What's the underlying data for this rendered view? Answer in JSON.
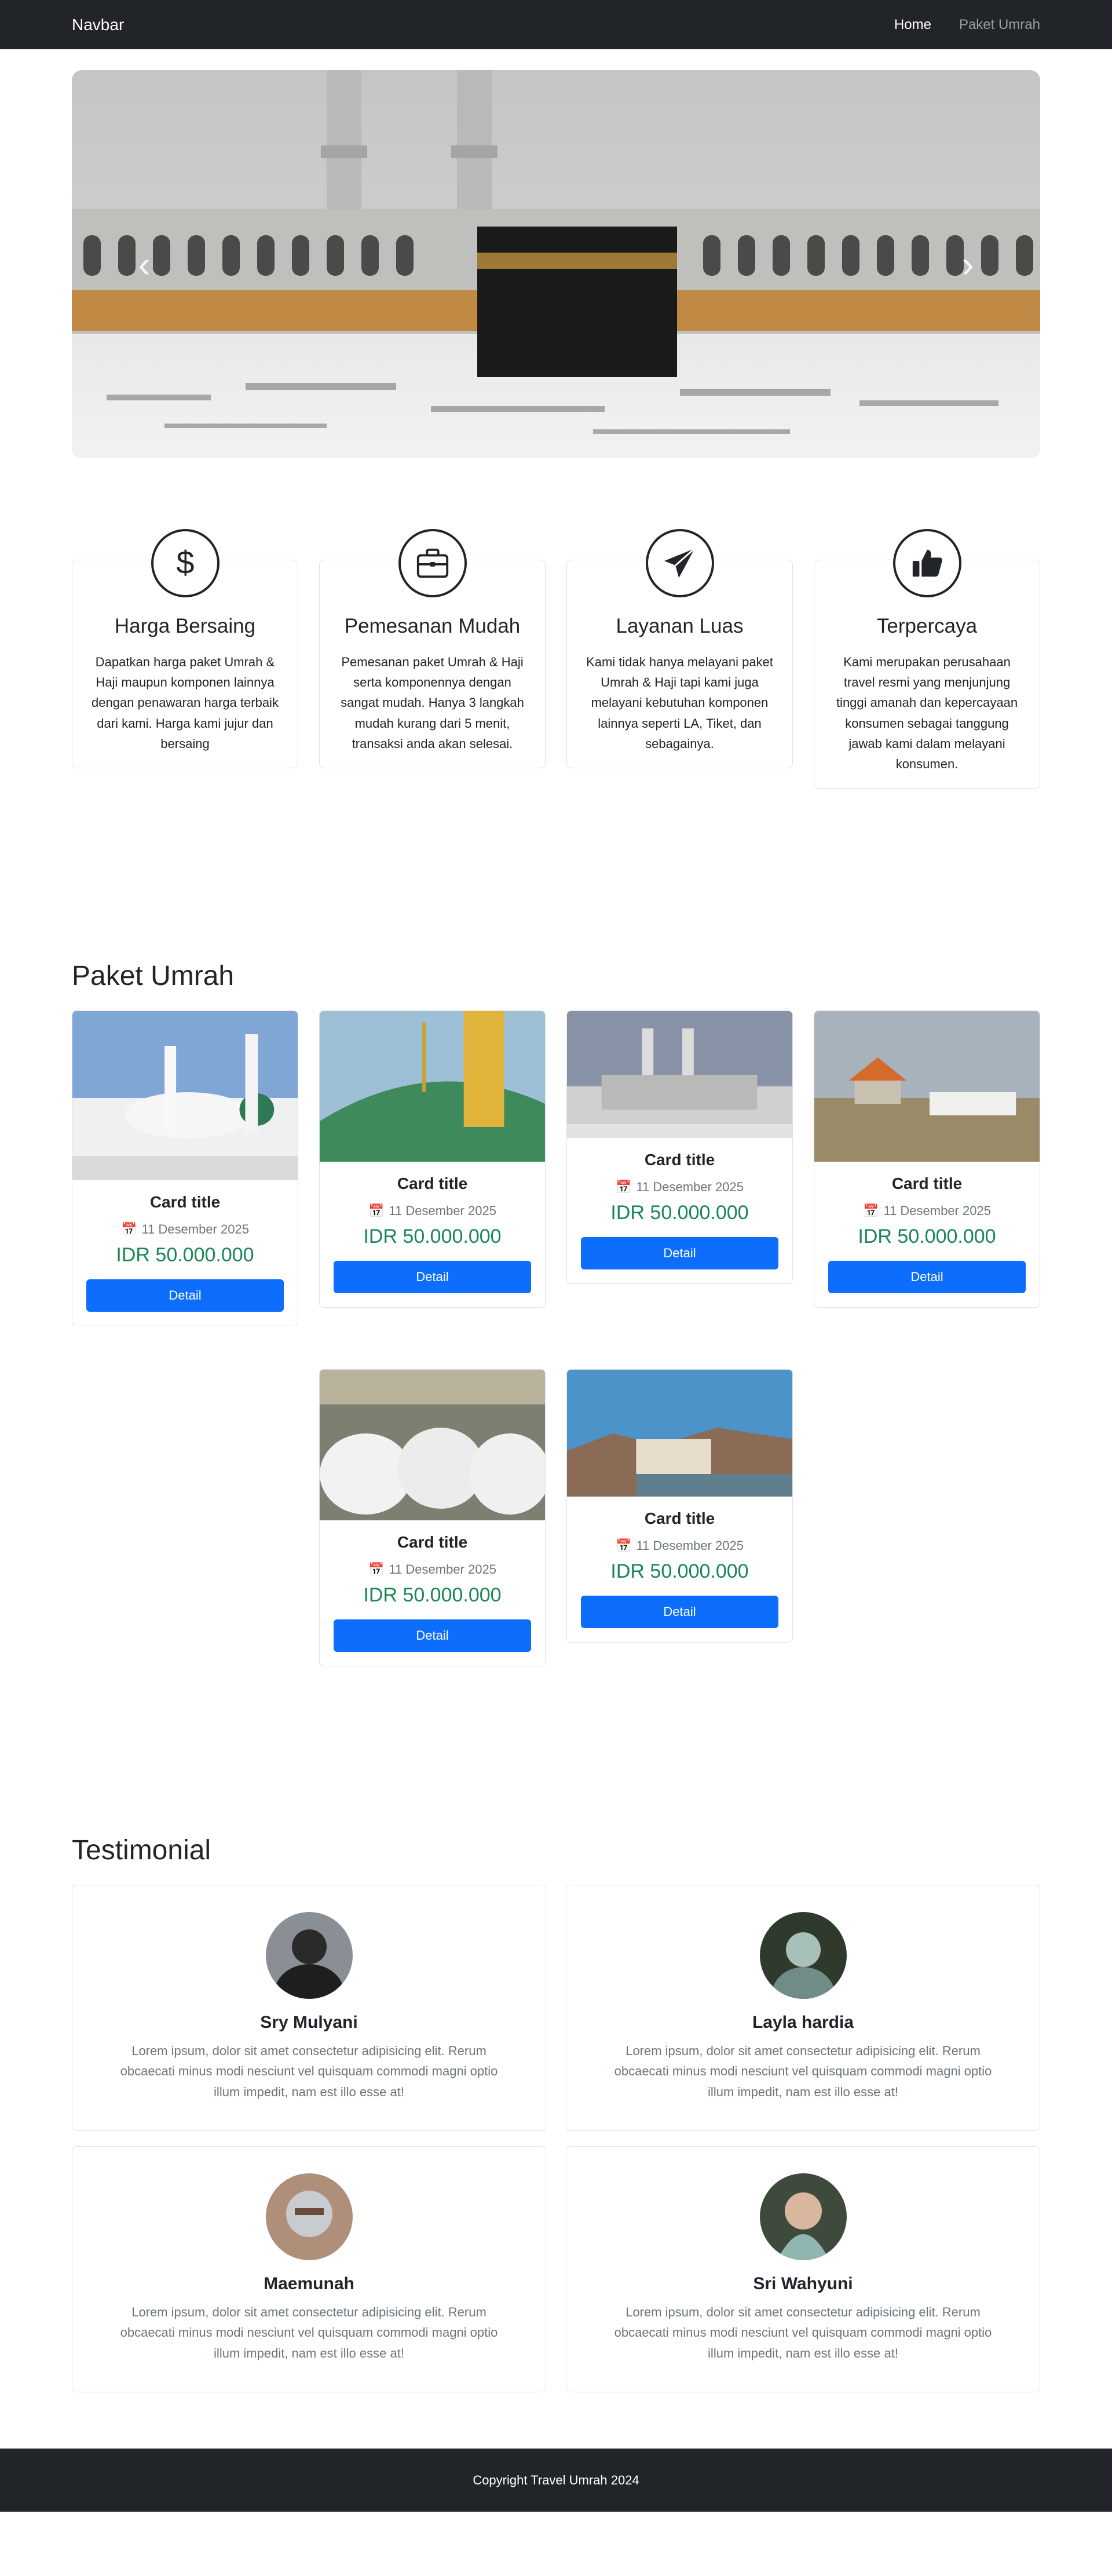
{
  "navbar": {
    "brand": "Navbar",
    "links": [
      {
        "label": "Home",
        "active": true
      },
      {
        "label": "Paket Umrah",
        "active": false
      }
    ]
  },
  "carousel": {
    "image": "kaaba-masjidil-haram-photo",
    "prev_icon": "chevron-left-icon",
    "next_icon": "chevron-right-icon"
  },
  "features": [
    {
      "icon": "dollar-icon",
      "title": "Harga Bersaing",
      "desc": "Dapatkan harga paket Umrah & Haji maupun komponen lainnya dengan penawaran harga terbaik dari kami. Harga kami jujur dan bersaing"
    },
    {
      "icon": "briefcase-icon",
      "title": "Pemesanan Mudah",
      "desc": "Pemesanan paket Umrah & Haji serta komponennya dengan sangat mudah. Hanya 3 langkah mudah kurang dari 5 menit, transaksi anda akan selesai."
    },
    {
      "icon": "paper-plane-icon",
      "title": "Layanan Luas",
      "desc": "Kami tidak hanya melayani paket Umrah & Haji tapi kami juga melayani kebutuhan komponen lainnya seperti LA, Tiket, dan sebagainya."
    },
    {
      "icon": "thumbs-up-icon",
      "title": "Terpercaya",
      "desc": "Kami merupakan perusahaan travel resmi yang menjunjung tinggi amanah dan kepercayaan konsumen sebagai tanggung jawab kami dalam melayani konsumen."
    }
  ],
  "paket": {
    "title": "Paket Umrah",
    "cards": [
      {
        "image": "mosque-white-green-dome",
        "title": "Card title",
        "date": "11 Desember 2025",
        "price": "IDR 50.000.000",
        "button": "Detail"
      },
      {
        "image": "green-dome-minaret",
        "title": "Card title",
        "date": "11 Desember 2025",
        "price": "IDR 50.000.000",
        "button": "Detail"
      },
      {
        "image": "mosque-grey-minarets",
        "title": "Card title",
        "date": "11 Desember 2025",
        "price": "IDR 50.000.000",
        "button": "Detail"
      },
      {
        "image": "pilgrims-field-tent",
        "title": "Card title",
        "date": "11 Desember 2025",
        "price": "IDR 50.000.000",
        "button": "Detail"
      },
      {
        "image": "pilgrims-praying",
        "title": "Card title",
        "date": "11 Desember 2025",
        "price": "IDR 50.000.000",
        "button": "Detail"
      },
      {
        "image": "mosque-harbor-mountains",
        "title": "Card title",
        "date": "11 Desember 2025",
        "price": "IDR 50.000.000",
        "button": "Detail"
      }
    ]
  },
  "testimonial": {
    "title": "Testimonial",
    "items": [
      {
        "avatar": "avatar-photo",
        "name": "Sry Mulyani",
        "text": "Lorem ipsum, dolor sit amet consectetur adipisicing elit. Rerum obcaecati minus modi nesciunt vel quisquam commodi magni optio illum impedit, nam est illo esse at!"
      },
      {
        "avatar": "avatar-photo",
        "name": "Layla hardia",
        "text": "Lorem ipsum, dolor sit amet consectetur adipisicing elit. Rerum obcaecati minus modi nesciunt vel quisquam commodi magni optio illum impedit, nam est illo esse at!"
      },
      {
        "avatar": "avatar-photo",
        "name": "Maemunah",
        "text": "Lorem ipsum, dolor sit amet consectetur adipisicing elit. Rerum obcaecati minus modi nesciunt vel quisquam commodi magni optio illum impedit, nam est illo esse at!"
      },
      {
        "avatar": "avatar-photo",
        "name": "Sri Wahyuni",
        "text": "Lorem ipsum, dolor sit amet consectetur adipisicing elit. Rerum obcaecati minus modi nesciunt vel quisquam commodi magni optio illum impedit, nam est illo esse at!"
      }
    ]
  },
  "footer": {
    "text": "Copyright Travel Umrah 2024"
  },
  "colors": {
    "dark": "#212529",
    "primary": "#0d6efd",
    "success": "#198754",
    "muted": "#6c757d"
  }
}
